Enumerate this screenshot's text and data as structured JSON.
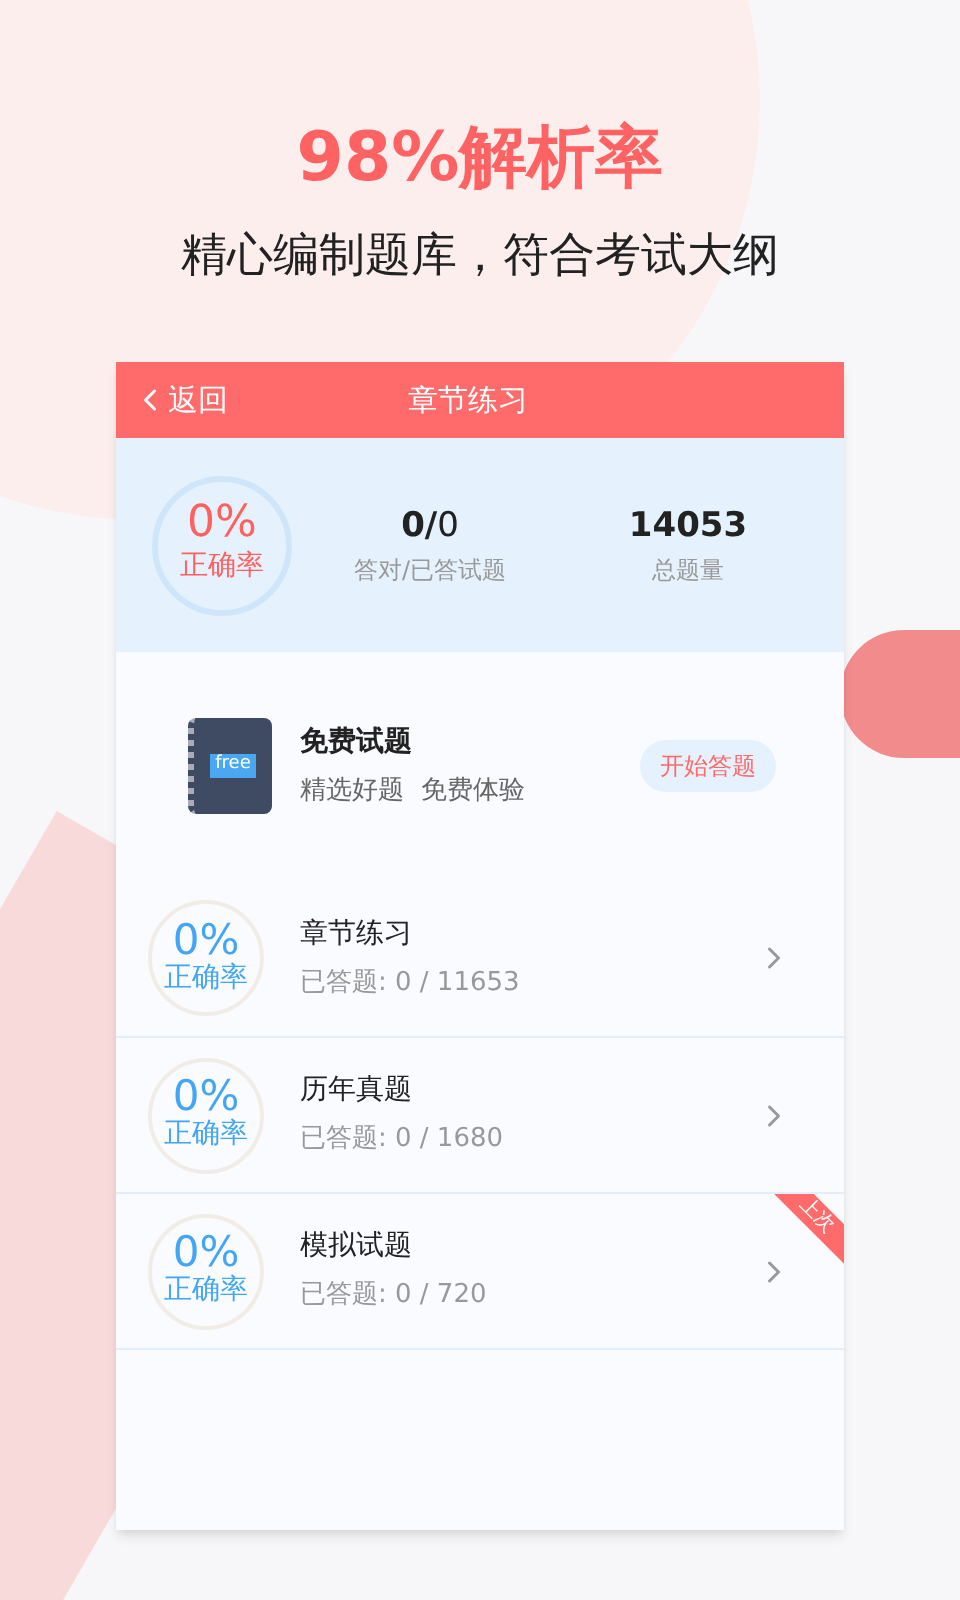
{
  "headline": "98%解析率",
  "subtitle": "精心编制题库，符合考试大纲",
  "header": {
    "back": "返回",
    "title": "章节练习"
  },
  "stats": {
    "rate": "0%",
    "rate_label": "正确率",
    "answered": "0/",
    "answered_total": "0",
    "answered_label": "答对/已答试题",
    "total": "14053",
    "total_label": "总题量"
  },
  "free": {
    "cover_text": "free",
    "title": "免费试题",
    "desc": "精选好题  免费体验",
    "button": "开始答题"
  },
  "sections": [
    {
      "rate": "0%",
      "rate_label": "正确率",
      "title": "章节练习",
      "progress": "已答题: 0 / 11653"
    },
    {
      "rate": "0%",
      "rate_label": "正确率",
      "title": "历年真题",
      "progress": "已答题: 0 / 1680"
    },
    {
      "rate": "0%",
      "rate_label": "正确率",
      "title": "模拟试题",
      "progress": "已答题: 0 / 720",
      "badge": "上次"
    }
  ]
}
